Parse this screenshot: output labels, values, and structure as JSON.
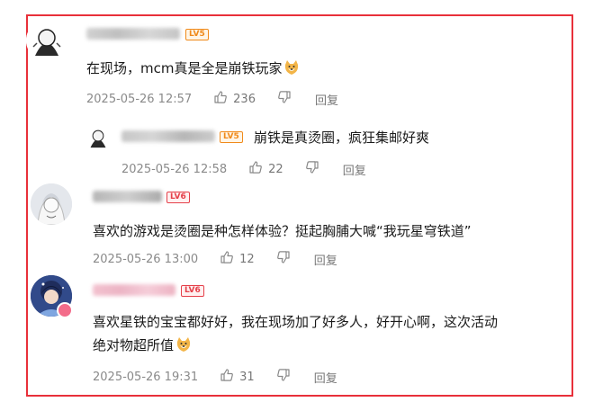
{
  "comments": [
    {
      "username_obscured": "Drq●●●●●●●",
      "level": "LV5",
      "text": "在现场，mcm真是全是崩铁玩家",
      "time": "2025-05-26 12:57",
      "likes": "236",
      "reply_label": "回复"
    },
    {
      "username_obscured": "H●●●●●●●●●",
      "level": "LV5",
      "text": "崩铁是真烫圈，疯狂集邮好爽",
      "time": "2025-05-26 12:58",
      "likes": "22",
      "reply_label": "回复"
    },
    {
      "username_obscured": "●●●●●●",
      "level": "LV6",
      "text": "喜欢的游戏是烫圈是种怎样体验？挺起胸脯大喊“我玩星穹铁道”",
      "time": "2025-05-26 13:00",
      "likes": "12",
      "reply_label": "回复"
    },
    {
      "username_obscured": "●●●●●●●●",
      "level": "LV6",
      "text_line1": "喜欢星铁的宝宝都好好，我在现场加了好多人，好开心啊，这次活动",
      "text_line2": "绝对物超所值",
      "time": "2025-05-26 19:31",
      "likes": "31",
      "reply_label": "回复"
    }
  ],
  "colors": {
    "frame": "#e8303a",
    "meta": "#8a8a8a",
    "lv5": "#f08a1a",
    "lv6": "#e5404a"
  },
  "icons": [
    "thumbs-up-icon",
    "thumbs-down-icon",
    "dog-emoji-icon"
  ]
}
